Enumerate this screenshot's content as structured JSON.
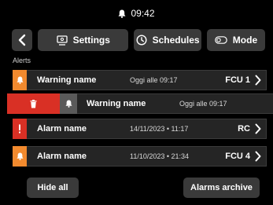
{
  "status": {
    "time": "09:42",
    "icon": "bell-icon"
  },
  "nav": {
    "back_icon": "chevron-left-icon",
    "settings": {
      "label": "Settings",
      "icon": "monitor-icon"
    },
    "schedules": {
      "label": "Schedules",
      "icon": "clock-icon"
    },
    "mode": {
      "label": "Mode",
      "icon": "toggle-icon"
    }
  },
  "alerts": {
    "section_label": "Alerts",
    "items": [
      {
        "name": "Warning name",
        "time": "Oggi alle 09:17",
        "target": "FCU 1",
        "kind": "warning",
        "color": "#f28a2e",
        "icon": "bell-icon"
      },
      {
        "name": "Warning name",
        "time": "Oggi alle 09:17",
        "target": "",
        "kind": "warning-swiped",
        "color": "#5a5a5a",
        "icon": "bell-icon",
        "action_icon": "trash-icon",
        "action_color": "#d93025"
      },
      {
        "name": "Alarm name",
        "time": "14/11/2023 • 11:17",
        "target": "RC",
        "kind": "alarm",
        "color": "#d93025",
        "icon": "exclamation-icon"
      },
      {
        "name": "Alarm name",
        "time": "11/10/2023 • 21:34",
        "target": "FCU 4",
        "kind": "alarm",
        "color": "#f28a2e",
        "icon": "bell-icon"
      }
    ]
  },
  "footer": {
    "hide_all": "Hide all",
    "archive": "Alarms archive"
  }
}
